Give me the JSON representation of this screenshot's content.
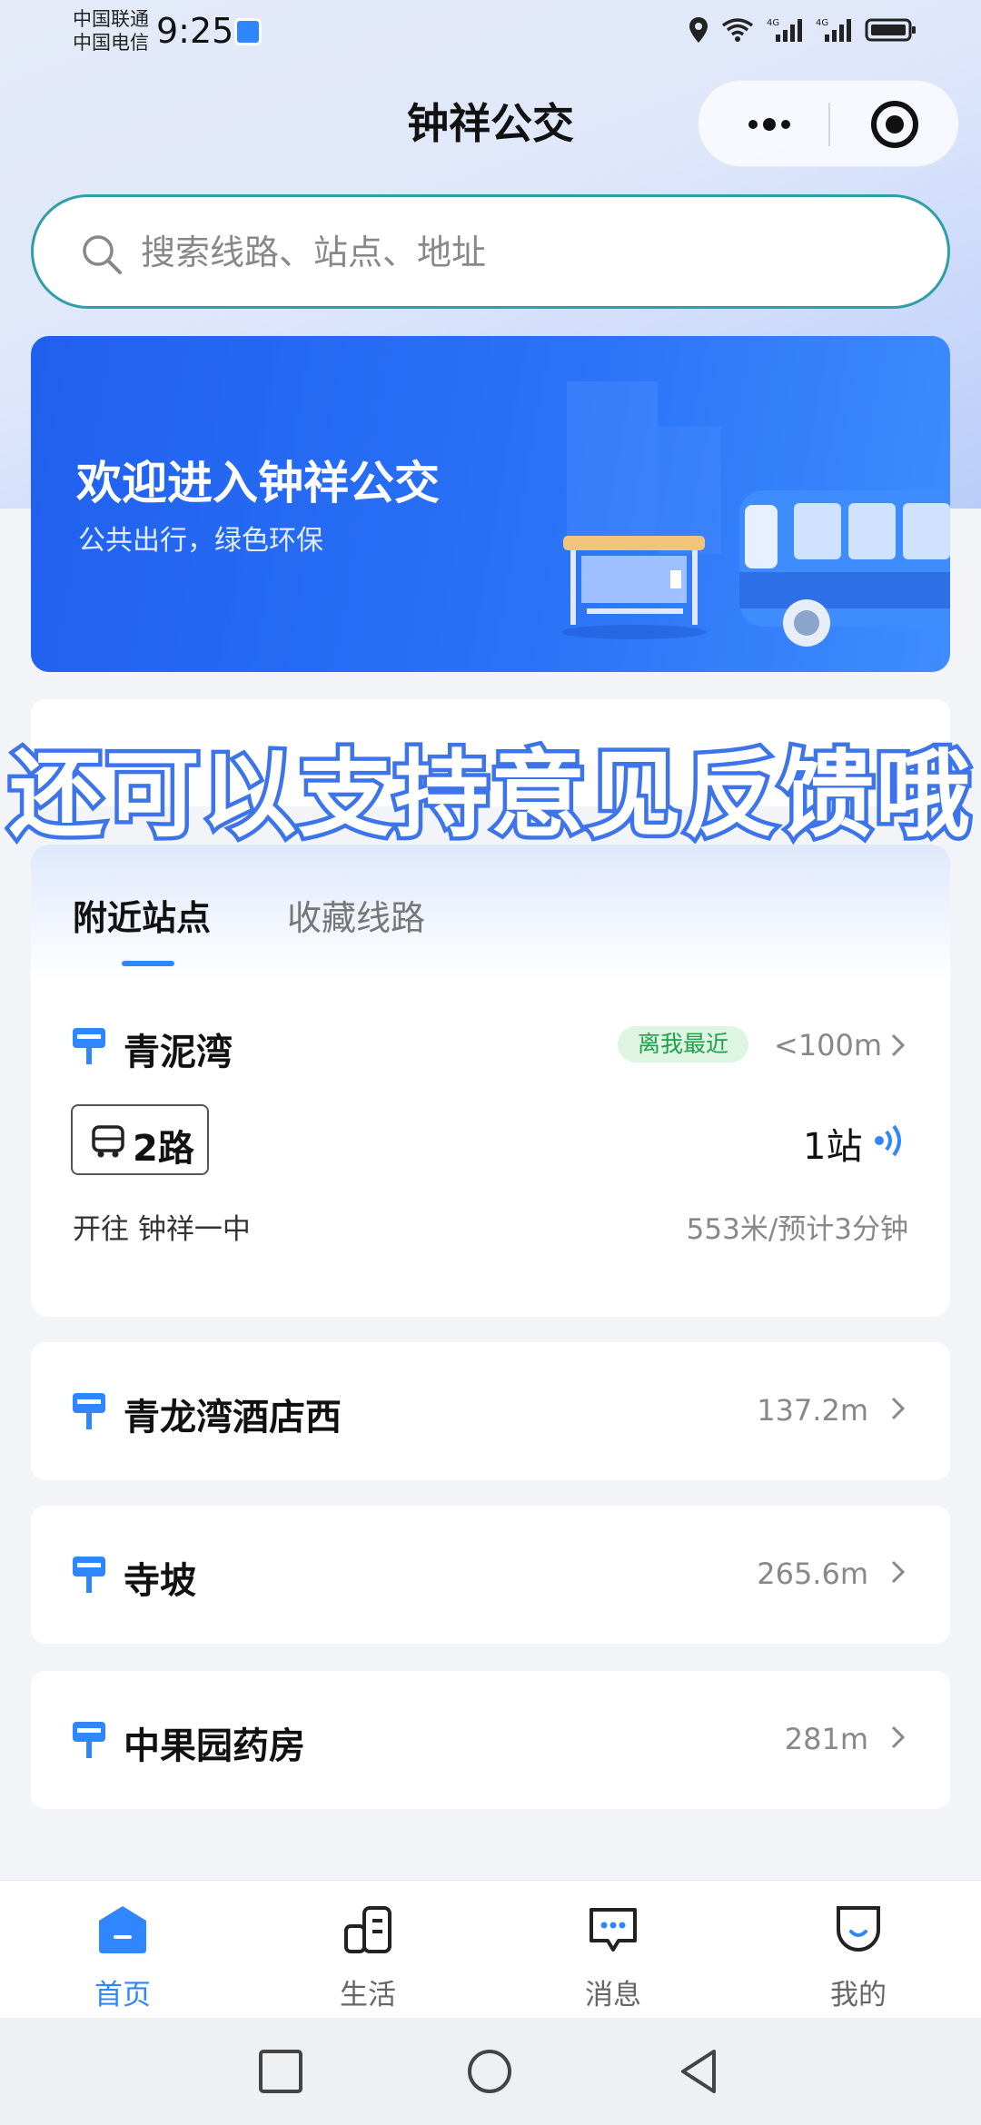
{
  "status_bar": {
    "carrier_1": "中国联通",
    "carrier_2": "中国电信",
    "time": "9:25",
    "network_1": "4G",
    "network_2": "4G"
  },
  "header": {
    "title": "钟祥公交"
  },
  "search": {
    "placeholder": "搜索线路、站点、地址"
  },
  "banner": {
    "title": "欢迎进入钟祥公交",
    "subtitle": "公共出行，绿色环保"
  },
  "overlay_caption": "还可以支持意见反馈哦",
  "tabs": {
    "nearby": "附近站点",
    "favorites": "收藏线路"
  },
  "nearest_stop": {
    "name": "青泥湾",
    "badge": "离我最近",
    "distance": "<100m",
    "route": "2路",
    "stops_away": "1站",
    "direction": "开往 钟祥一中",
    "eta": "553米/预计3分钟"
  },
  "stops": [
    {
      "name": "青龙湾酒店西",
      "distance": "137.2m"
    },
    {
      "name": "寺坡",
      "distance": "265.6m"
    },
    {
      "name": "中果园药房",
      "distance": "281m"
    }
  ],
  "bottom_nav": [
    {
      "label": "首页",
      "icon": "home-icon",
      "active": true
    },
    {
      "label": "生活",
      "icon": "life-icon",
      "active": false
    },
    {
      "label": "消息",
      "icon": "message-icon",
      "active": false
    },
    {
      "label": "我的",
      "icon": "profile-icon",
      "active": false
    }
  ],
  "colors": {
    "accent": "#2f86ff",
    "banner": "#2a6cf4",
    "search_border": "#2f9ea9",
    "near_badge_text": "#1fa04b"
  }
}
